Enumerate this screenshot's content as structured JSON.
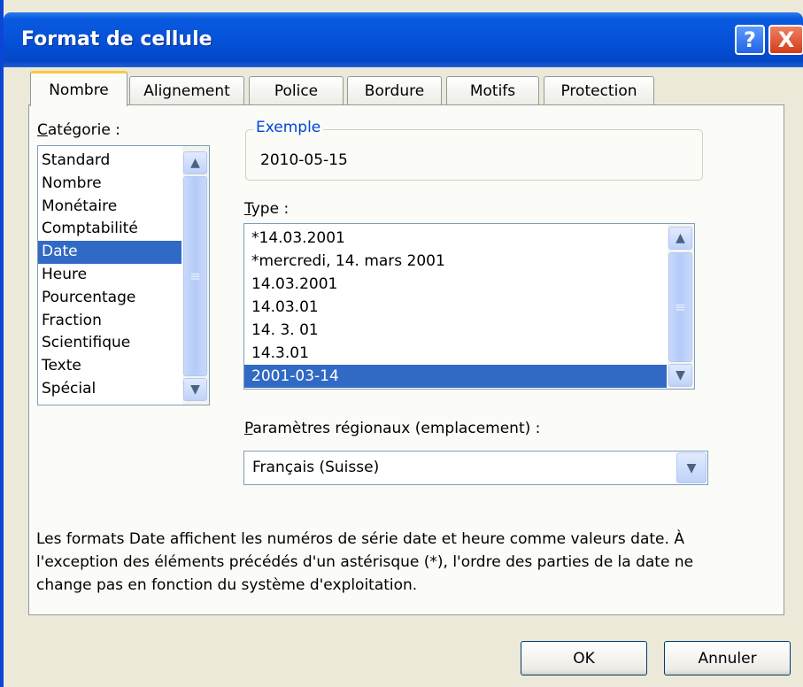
{
  "dialog": {
    "title": "Format de cellule"
  },
  "titlebar": {
    "help": "?",
    "close": "X"
  },
  "tabs": [
    "Nombre",
    "Alignement",
    "Police",
    "Bordure",
    "Motifs",
    "Protection"
  ],
  "categorie": {
    "label_accel": "C",
    "label_rest": "atégorie :",
    "items": [
      "Standard",
      "Nombre",
      "Monétaire",
      "Comptabilité",
      "Date",
      "Heure",
      "Pourcentage",
      "Fraction",
      "Scientifique",
      "Texte",
      "Spécial"
    ],
    "selected": "Date"
  },
  "exemple": {
    "label": "Exemple",
    "value": "2010-05-15"
  },
  "type": {
    "label_accel": "T",
    "label_rest": "ype :",
    "items": [
      "*14.03.2001",
      "*mercredi, 14. mars 2001",
      "14.03.2001",
      "14.03.01",
      "14. 3. 01",
      "14.3.01",
      "2001-03-14"
    ],
    "selected": "2001-03-14"
  },
  "regional": {
    "label_accel": "P",
    "label_rest": "aramètres régionaux (emplacement) :",
    "value": "Français (Suisse)"
  },
  "description": "Les formats Date affichent les numéros de série date et heure comme valeurs date. À l'exception des éléments précédés d'un astérisque (*), l'ordre des parties de la date ne change pas en fonction du système d'exploitation.",
  "buttons": {
    "ok": "OK",
    "cancel": "Annuler"
  },
  "icons": {
    "scroll_up": "▲",
    "scroll_down": "▼",
    "grip": "≡",
    "dropdown": "chevron-down-icon"
  },
  "colors": {
    "titlebar": "#0552d8",
    "selection": "#316ac5",
    "active_tab_accent": "#ffc83c",
    "group_label": "#0046d5"
  }
}
